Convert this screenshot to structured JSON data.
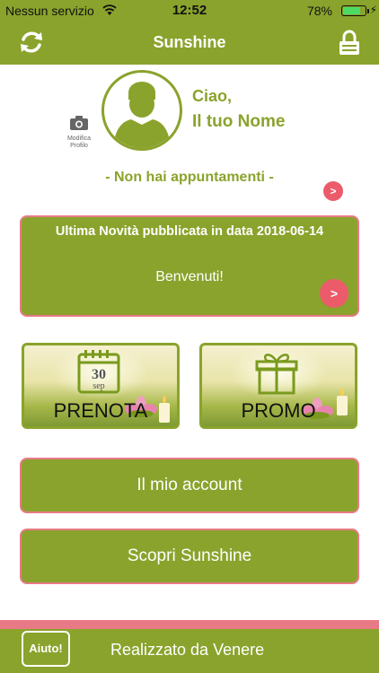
{
  "status_bar": {
    "carrier": "Nessun servizio",
    "time": "12:52",
    "battery": "78%",
    "battery_level": 0.78
  },
  "nav": {
    "title": "Sunshine",
    "left_icon": "refresh-icon",
    "right_icon": "lock-icon"
  },
  "profile": {
    "edit_label_line1": "Modifica",
    "edit_label_line2": "Profilo",
    "greeting": "Ciao,",
    "name": "Il tuo Nome",
    "appointments": "- Non hai appuntamenti -",
    "arrow": ">"
  },
  "news": {
    "title": "Ultima Novità pubblicata in data 2018-06-14",
    "body": "Benvenuti!",
    "arrow": ">"
  },
  "tiles": {
    "prenota": {
      "label": "PRENOTA",
      "calendar_day": "30",
      "calendar_month": "sep",
      "icon": "calendar-icon"
    },
    "promo": {
      "label": "PROMO",
      "icon": "gift-icon"
    }
  },
  "buttons": {
    "account": "Il mio account",
    "scopri": "Scopri Sunshine"
  },
  "footer": {
    "help": "Aiuto!",
    "credit": "Realizzato da Venere"
  },
  "colors": {
    "primary": "#8aa32c",
    "accent": "#e87a86",
    "arrow": "#ec5b6a"
  }
}
